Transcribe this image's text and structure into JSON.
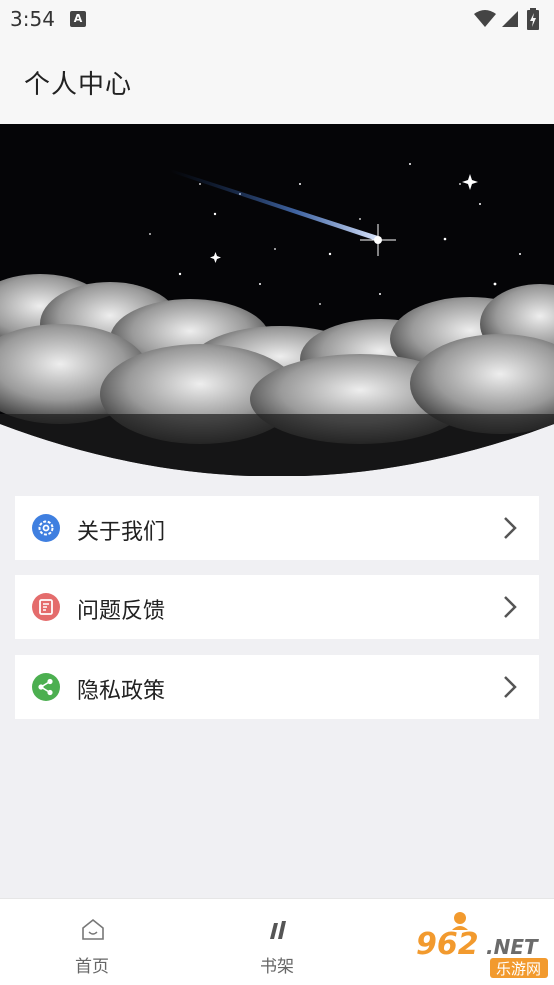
{
  "status_bar": {
    "time": "3:54",
    "notification_icon": "a-letter-icon",
    "icons": [
      "wifi-icon",
      "signal-icon",
      "battery-charging-icon"
    ]
  },
  "app_bar": {
    "title": "个人中心"
  },
  "hero": {
    "image": "night-sky-shooting-star-clouds"
  },
  "menu": {
    "items": [
      {
        "label": "关于我们",
        "icon": "settings-gear-icon",
        "icon_color": "#3f7fe0"
      },
      {
        "label": "问题反馈",
        "icon": "feedback-edit-icon",
        "icon_color": "#e46c6c"
      },
      {
        "label": "隐私政策",
        "icon": "share-icon",
        "icon_color": "#4caf50"
      }
    ]
  },
  "tab_bar": {
    "tabs": [
      {
        "label": "首页",
        "icon": "home-icon"
      },
      {
        "label": "书架",
        "icon": "bookshelf-icon"
      },
      {
        "label": "",
        "icon": "profile-icon"
      }
    ]
  },
  "watermark": {
    "text": "962.NET",
    "subtext": "乐游网"
  }
}
